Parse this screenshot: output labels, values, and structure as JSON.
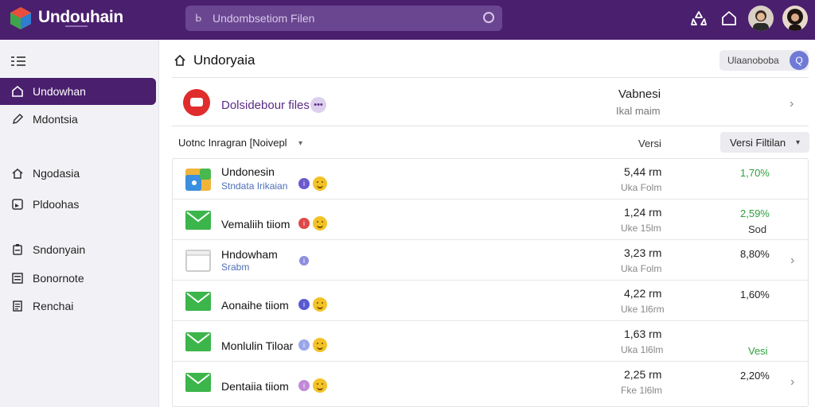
{
  "app": {
    "title": "Undouhain",
    "search_placeholder": "Undombsetiom Filen"
  },
  "sidebar": {
    "items": [
      {
        "label": "Undowhan",
        "icon": "home-icon",
        "active": true
      },
      {
        "label": "Mdontsia",
        "icon": "pencil-icon",
        "active": false
      },
      {
        "label": "Ngodasia",
        "icon": "house-icon",
        "active": false
      },
      {
        "label": "Pldoohas",
        "icon": "photo-icon",
        "active": false
      },
      {
        "label": "Sndonyain",
        "icon": "clipboard-icon",
        "active": false
      },
      {
        "label": "Bonornote",
        "icon": "list-icon",
        "active": false
      },
      {
        "label": "Renchai",
        "icon": "document-icon",
        "active": false
      }
    ]
  },
  "main": {
    "title": "Undoryaia",
    "header_button": "Ulaanoboba",
    "header_button_badge": "Q",
    "card": {
      "label": "Dolsidebour files",
      "badge": "•••",
      "top_text": "Vabnesi",
      "bottom_text": "Ikal maim"
    },
    "filter_label": "Uotnc Inragran [Noivepl",
    "column_header": "Versi",
    "filter_button": "Versi Filtilan"
  },
  "rows": [
    {
      "name": "Undonesin",
      "sub": "Stndata Irikaian",
      "icon": "app-icon",
      "dot_color": "#6a5acd",
      "size": "5,44 rm",
      "size_sub": "Uka Folm",
      "pct": "1,70%",
      "pct_color": "#2e9e3b",
      "pct_sub": "",
      "chevron": false
    },
    {
      "name": "Vemaliih tiiom",
      "sub": "",
      "icon": "mail-icon",
      "dot_color": "#e04848",
      "size": "1,24 rm",
      "size_sub": "Uke 15lm",
      "pct": "2,59%",
      "pct_color": "#2e9e3b",
      "pct_sub": "Sod",
      "chevron": false
    },
    {
      "name": "Hndowham",
      "sub": "Srabm",
      "icon": "file-icon",
      "dot_color": "#8d8de0",
      "size": "3,23 rm",
      "size_sub": "Uka Folm",
      "pct": "8,80%",
      "pct_color": "#222222",
      "pct_sub": "",
      "chevron": true
    },
    {
      "name": "Aonaihe tiiom",
      "sub": "",
      "icon": "mail-icon",
      "dot_color": "#5a5ad0",
      "size": "4,22 rm",
      "size_sub": "Uke 1l6rm",
      "pct": "1,60%",
      "pct_color": "#222222",
      "pct_sub": "",
      "chevron": false
    },
    {
      "name": "Monlulin Tiloar",
      "sub": "",
      "icon": "mail-icon",
      "dot_color": "#9aa6ea",
      "size": "1,63 rm",
      "size_sub": "Uka 1l6lm",
      "pct": "",
      "pct_color": "#2e9e3b",
      "pct_sub": "Vesi",
      "chevron": false
    },
    {
      "name": "Dentaiia tiiom",
      "sub": "",
      "icon": "mail-icon",
      "dot_color": "#c08ad8",
      "size": "2,25 rm",
      "size_sub": "Fke 1l6lm",
      "pct": "2,20%",
      "pct_color": "#222222",
      "pct_sub": "",
      "chevron": true
    }
  ]
}
